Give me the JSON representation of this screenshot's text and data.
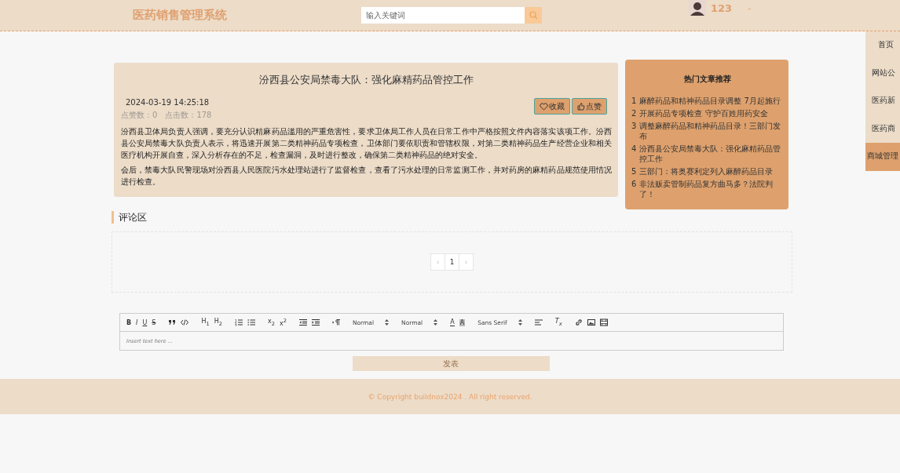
{
  "header": {
    "title": "医药销售管理系统",
    "search": {
      "placeholder": "输入关键词"
    },
    "user": {
      "name": "123",
      "caret": "-"
    }
  },
  "sidebar": {
    "items": [
      {
        "label": "首页",
        "selected": false
      },
      {
        "label": "网站公",
        "selected": false
      },
      {
        "label": "医药新",
        "selected": false
      },
      {
        "label": "医药商",
        "selected": false
      },
      {
        "label": "商城管理",
        "selected": true
      }
    ]
  },
  "article": {
    "title": "汾西县公安局禁毒大队：强化麻精药品管控工作",
    "date": "2024-03-19 14:25:18",
    "likes": "点赞数：0",
    "clicks": "点击数：178",
    "buttons": [
      {
        "kind": "favorite",
        "label": "收藏"
      },
      {
        "kind": "like",
        "label": "点赞"
      }
    ],
    "paragraphs": [
      "汾西县卫体局负责人强调，要充分认识精麻药品滥用的严重危害性，要求卫体局工作人员在日常工作中严格按照文件内容落实该项工作。汾西县公安局禁毒大队负责人表示，将迅速开展第二类精神药品专项检查，卫体部门要依职责和管辖权限，对第二类精神药品生产经营企业和相关医疗机构开展自查，深入分析存在的不足，检查漏洞，及时进行整改，确保第二类精神药品的绝对安全。",
      "会后，禁毒大队民警现场对汾西县人民医院污水处理站进行了监督检查，查看了污水处理的日常监测工作，并对药房的麻精药品规范使用情况进行检查。"
    ]
  },
  "hot": {
    "title": "热门文章推荐",
    "items": [
      {
        "rank": "1",
        "title": "麻醉药品和精神药品目录调整 7月起施行"
      },
      {
        "rank": "2",
        "title": "开展药品专项检查 守护百姓用药安全"
      },
      {
        "rank": "3",
        "title": "调整麻醉药品和精神药品目录！三部门发布"
      },
      {
        "rank": "4",
        "title": "汾西县公安局禁毒大队：强化麻精药品管控工作"
      },
      {
        "rank": "5",
        "title": "三部门：将奥赛利定列入麻醉药品目录"
      },
      {
        "rank": "6",
        "title": "非法贩卖管制药品复方曲马多？法院判了！"
      }
    ]
  },
  "comments": {
    "title": "评论区",
    "pagination": {
      "prev": "‹",
      "pages": [
        {
          "label": "1",
          "selected": true
        }
      ],
      "next": "›"
    }
  },
  "editor": {
    "toolbar": [
      {
        "kind": "text",
        "label": "B"
      },
      {
        "kind": "text",
        "label": "I"
      },
      {
        "kind": "text",
        "label": "U"
      },
      {
        "kind": "text",
        "label": "S"
      },
      {
        "kind": "icon"
      },
      {
        "kind": "icon"
      },
      {
        "kind": "text",
        "label": "H$_{1}$"
      },
      {
        "kind": "text",
        "label": "H$_{2}$"
      },
      {
        "kind": "icon"
      },
      {
        "kind": "icon"
      },
      {
        "kind": "text",
        "label": "x$_{2}$"
      },
      {
        "kind": "text",
        "label": "x$^{2}$"
      },
      {
        "kind": "icon"
      },
      {
        "kind": "icon"
      },
      {
        "kind": "icon"
      },
      {
        "kind": "select",
        "label": "Normal"
      },
      {
        "kind": "select",
        "label": "Normal"
      },
      {
        "kind": "text",
        "label": "A"
      },
      {
        "kind": "text",
        "label": "A"
      },
      {
        "kind": "select",
        "label": "Sans Serif"
      },
      {
        "kind": "icon"
      },
      {
        "kind": "text",
        "label": "T$_{x}$"
      },
      {
        "kind": "icon"
      },
      {
        "kind": "icon"
      },
      {
        "kind": "icon"
      }
    ],
    "placeholder": "Insert text here ...",
    "submit": "发表"
  },
  "footer": {
    "text": "© Copyright buildnox2024 . All right reserved."
  }
}
